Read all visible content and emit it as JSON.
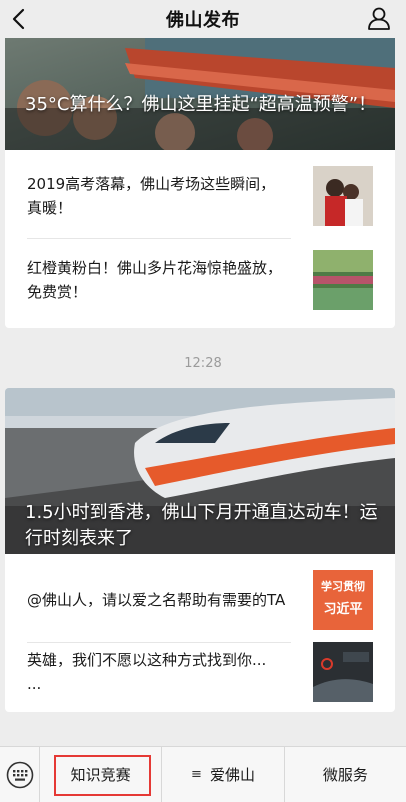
{
  "navbar": {
    "title": "佛山发布",
    "back_icon": "chevron-left-icon",
    "profile_icon": "person-icon"
  },
  "feed": {
    "group1": {
      "hero_title": "35°C算什么？佛山这里挂起“超高温预警”！",
      "items": [
        {
          "title": "2019高考落幕，佛山考场这些瞬间，真暖！"
        },
        {
          "title": "红橙黄粉白！佛山多片花海惊艳盛放，免费赏！"
        }
      ]
    },
    "timestamp": "12:28",
    "group2": {
      "hero_title": "1.5小时到香港，佛山下月开通直达动车！运行时刻表来了",
      "items": [
        {
          "title": "@佛山人，请以爱之名帮助有需要的TA",
          "thumb_line1": "学习贯彻",
          "thumb_line2": "习近平"
        },
        {
          "title": "英雄，我们不愿以这种方式找到你...\n..."
        }
      ]
    }
  },
  "bottom_bar": {
    "keyboard_icon": "keyboard-icon",
    "menus": [
      {
        "label": "知识竞赛"
      },
      {
        "label": "爱佛山",
        "icon": "menu-list-icon"
      },
      {
        "label": "微服务"
      }
    ]
  },
  "colors": {
    "background": "#ededed",
    "highlight": "#e53935",
    "timestamp": "#9b9b9b"
  }
}
